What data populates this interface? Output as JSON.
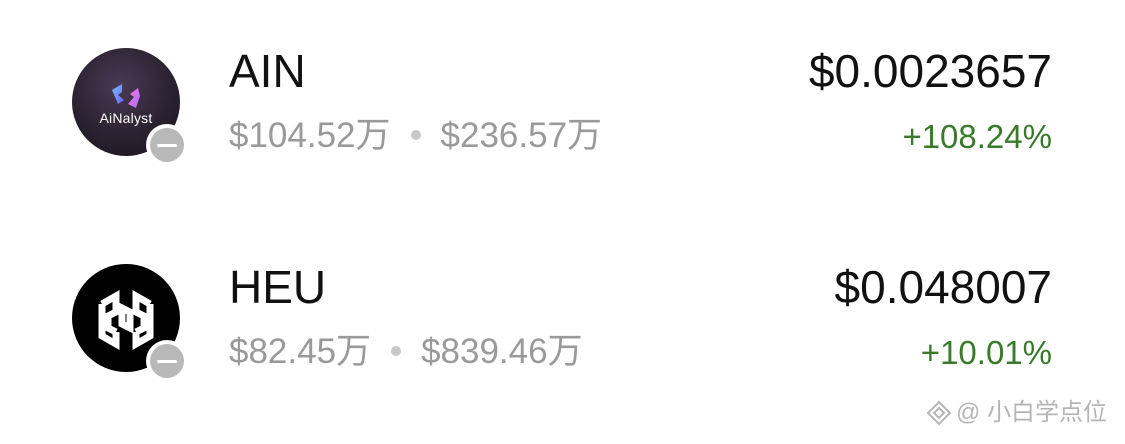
{
  "assets": [
    {
      "symbol": "AIN",
      "logo_icon": "ainalyst-logo-icon",
      "logo_text": "AiNalyst",
      "stat1": "$104.52万",
      "stat2": "$236.57万",
      "price": "$0.0023657",
      "change": "+108.24%"
    },
    {
      "symbol": "HEU",
      "logo_icon": "heu-logo-icon",
      "stat1": "$82.45万",
      "stat2": "$839.46万",
      "price": "$0.048007",
      "change": "+10.01%"
    }
  ],
  "colors": {
    "positive_change": "#3a7a2a",
    "muted_text": "#9a9a9a",
    "primary_text": "#111111",
    "badge": "#b9b9b9"
  },
  "watermark": {
    "text": "@ 小白学点位",
    "icon": "watermark-logo-icon"
  }
}
